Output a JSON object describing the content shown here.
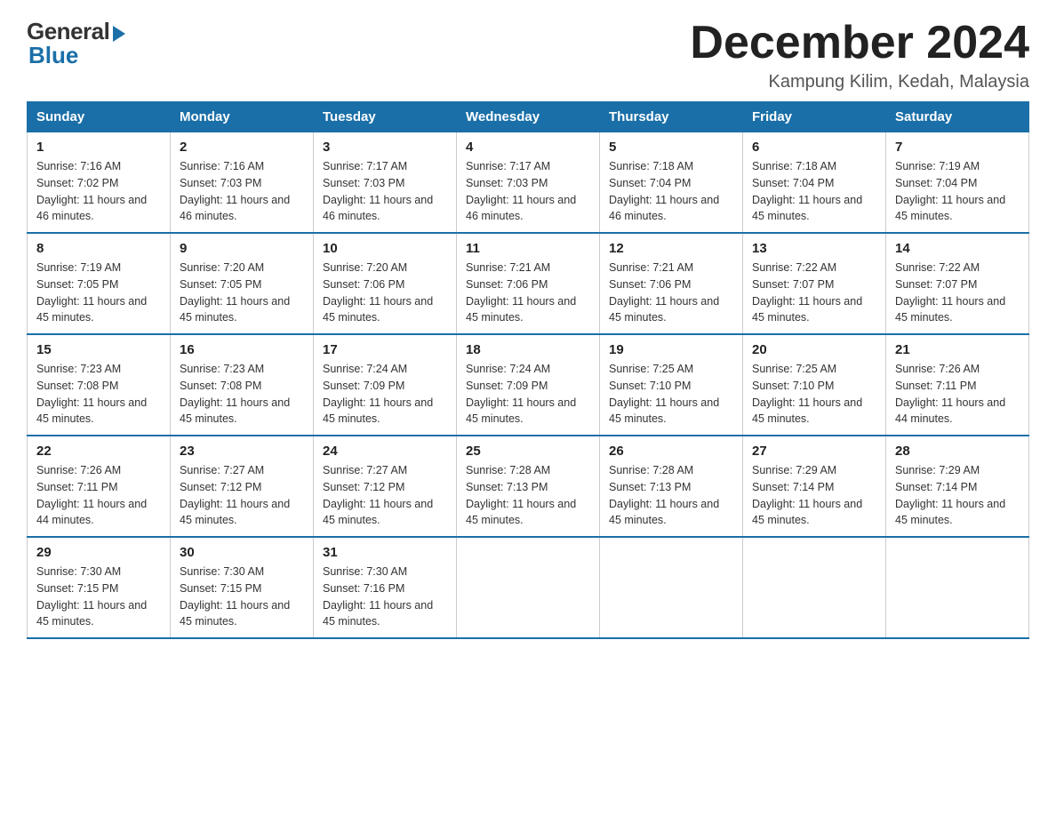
{
  "logo": {
    "general": "General",
    "blue": "Blue"
  },
  "header": {
    "month_year": "December 2024",
    "location": "Kampung Kilim, Kedah, Malaysia"
  },
  "weekdays": [
    "Sunday",
    "Monday",
    "Tuesday",
    "Wednesday",
    "Thursday",
    "Friday",
    "Saturday"
  ],
  "weeks": [
    [
      {
        "day": "1",
        "sunrise": "7:16 AM",
        "sunset": "7:02 PM",
        "daylight": "11 hours and 46 minutes."
      },
      {
        "day": "2",
        "sunrise": "7:16 AM",
        "sunset": "7:03 PM",
        "daylight": "11 hours and 46 minutes."
      },
      {
        "day": "3",
        "sunrise": "7:17 AM",
        "sunset": "7:03 PM",
        "daylight": "11 hours and 46 minutes."
      },
      {
        "day": "4",
        "sunrise": "7:17 AM",
        "sunset": "7:03 PM",
        "daylight": "11 hours and 46 minutes."
      },
      {
        "day": "5",
        "sunrise": "7:18 AM",
        "sunset": "7:04 PM",
        "daylight": "11 hours and 46 minutes."
      },
      {
        "day": "6",
        "sunrise": "7:18 AM",
        "sunset": "7:04 PM",
        "daylight": "11 hours and 45 minutes."
      },
      {
        "day": "7",
        "sunrise": "7:19 AM",
        "sunset": "7:04 PM",
        "daylight": "11 hours and 45 minutes."
      }
    ],
    [
      {
        "day": "8",
        "sunrise": "7:19 AM",
        "sunset": "7:05 PM",
        "daylight": "11 hours and 45 minutes."
      },
      {
        "day": "9",
        "sunrise": "7:20 AM",
        "sunset": "7:05 PM",
        "daylight": "11 hours and 45 minutes."
      },
      {
        "day": "10",
        "sunrise": "7:20 AM",
        "sunset": "7:06 PM",
        "daylight": "11 hours and 45 minutes."
      },
      {
        "day": "11",
        "sunrise": "7:21 AM",
        "sunset": "7:06 PM",
        "daylight": "11 hours and 45 minutes."
      },
      {
        "day": "12",
        "sunrise": "7:21 AM",
        "sunset": "7:06 PM",
        "daylight": "11 hours and 45 minutes."
      },
      {
        "day": "13",
        "sunrise": "7:22 AM",
        "sunset": "7:07 PM",
        "daylight": "11 hours and 45 minutes."
      },
      {
        "day": "14",
        "sunrise": "7:22 AM",
        "sunset": "7:07 PM",
        "daylight": "11 hours and 45 minutes."
      }
    ],
    [
      {
        "day": "15",
        "sunrise": "7:23 AM",
        "sunset": "7:08 PM",
        "daylight": "11 hours and 45 minutes."
      },
      {
        "day": "16",
        "sunrise": "7:23 AM",
        "sunset": "7:08 PM",
        "daylight": "11 hours and 45 minutes."
      },
      {
        "day": "17",
        "sunrise": "7:24 AM",
        "sunset": "7:09 PM",
        "daylight": "11 hours and 45 minutes."
      },
      {
        "day": "18",
        "sunrise": "7:24 AM",
        "sunset": "7:09 PM",
        "daylight": "11 hours and 45 minutes."
      },
      {
        "day": "19",
        "sunrise": "7:25 AM",
        "sunset": "7:10 PM",
        "daylight": "11 hours and 45 minutes."
      },
      {
        "day": "20",
        "sunrise": "7:25 AM",
        "sunset": "7:10 PM",
        "daylight": "11 hours and 45 minutes."
      },
      {
        "day": "21",
        "sunrise": "7:26 AM",
        "sunset": "7:11 PM",
        "daylight": "11 hours and 44 minutes."
      }
    ],
    [
      {
        "day": "22",
        "sunrise": "7:26 AM",
        "sunset": "7:11 PM",
        "daylight": "11 hours and 44 minutes."
      },
      {
        "day": "23",
        "sunrise": "7:27 AM",
        "sunset": "7:12 PM",
        "daylight": "11 hours and 45 minutes."
      },
      {
        "day": "24",
        "sunrise": "7:27 AM",
        "sunset": "7:12 PM",
        "daylight": "11 hours and 45 minutes."
      },
      {
        "day": "25",
        "sunrise": "7:28 AM",
        "sunset": "7:13 PM",
        "daylight": "11 hours and 45 minutes."
      },
      {
        "day": "26",
        "sunrise": "7:28 AM",
        "sunset": "7:13 PM",
        "daylight": "11 hours and 45 minutes."
      },
      {
        "day": "27",
        "sunrise": "7:29 AM",
        "sunset": "7:14 PM",
        "daylight": "11 hours and 45 minutes."
      },
      {
        "day": "28",
        "sunrise": "7:29 AM",
        "sunset": "7:14 PM",
        "daylight": "11 hours and 45 minutes."
      }
    ],
    [
      {
        "day": "29",
        "sunrise": "7:30 AM",
        "sunset": "7:15 PM",
        "daylight": "11 hours and 45 minutes."
      },
      {
        "day": "30",
        "sunrise": "7:30 AM",
        "sunset": "7:15 PM",
        "daylight": "11 hours and 45 minutes."
      },
      {
        "day": "31",
        "sunrise": "7:30 AM",
        "sunset": "7:16 PM",
        "daylight": "11 hours and 45 minutes."
      },
      {
        "day": "",
        "sunrise": "",
        "sunset": "",
        "daylight": ""
      },
      {
        "day": "",
        "sunrise": "",
        "sunset": "",
        "daylight": ""
      },
      {
        "day": "",
        "sunrise": "",
        "sunset": "",
        "daylight": ""
      },
      {
        "day": "",
        "sunrise": "",
        "sunset": "",
        "daylight": ""
      }
    ]
  ]
}
